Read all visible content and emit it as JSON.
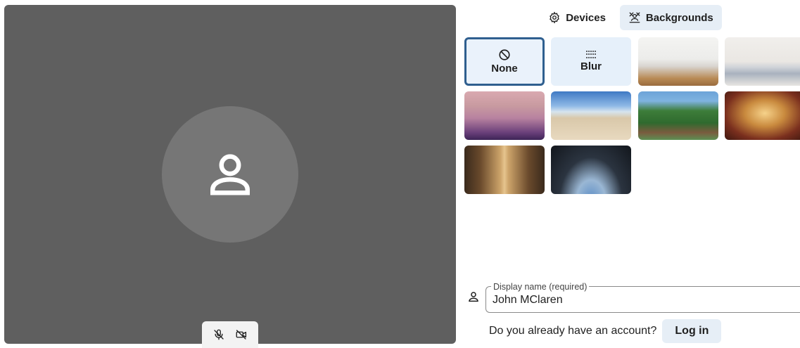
{
  "tabs": {
    "devices": "Devices",
    "backgrounds": "Backgrounds",
    "active": "backgrounds"
  },
  "backgrounds": {
    "none_label": "None",
    "blur_label": "Blur",
    "selected": "None",
    "images": [
      "office",
      "living-room",
      "sunset",
      "beach",
      "forest-bridge",
      "theater",
      "library",
      "space-station"
    ]
  },
  "display_name": {
    "label": "Display name (required)",
    "value": "John MClaren"
  },
  "account": {
    "prompt": "Do you already have an account?",
    "login_label": "Log in"
  },
  "icons": {
    "avatar": "person-icon",
    "mic": "mic-off-icon",
    "camera": "camera-off-icon",
    "devices": "gear-icon",
    "backgrounds": "background-effects-icon",
    "none": "prohibited-icon",
    "blur": "blur-dots-icon"
  },
  "colors": {
    "preview_bg": "#5f5f5f",
    "avatar_circle": "#767676",
    "selected_border": "#2f5f8f",
    "tab_active_bg": "#e6eef6"
  }
}
